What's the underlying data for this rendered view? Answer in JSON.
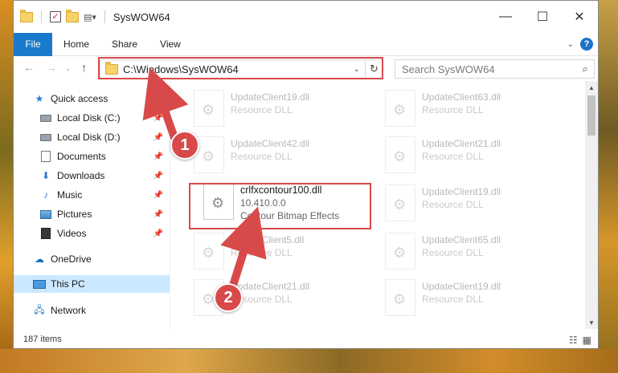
{
  "window": {
    "title": "SysWOW64",
    "controls": {
      "minimize": "—",
      "maximize": "☐",
      "close": "✕"
    }
  },
  "ribbon": {
    "tabs": [
      "File",
      "Home",
      "Share",
      "View"
    ]
  },
  "address": {
    "path": "C:\\Windows\\SysWOW64",
    "search_placeholder": "Search SysWOW64"
  },
  "nav": {
    "items": [
      {
        "label": "Quick access",
        "icon": "star-icon"
      },
      {
        "label": "Local Disk (C:)",
        "icon": "disk-icon",
        "pinned": true
      },
      {
        "label": "Local Disk (D:)",
        "icon": "disk-icon",
        "pinned": true
      },
      {
        "label": "Documents",
        "icon": "document-icon",
        "pinned": true
      },
      {
        "label": "Downloads",
        "icon": "download-icon",
        "pinned": true
      },
      {
        "label": "Music",
        "icon": "music-icon",
        "pinned": true
      },
      {
        "label": "Pictures",
        "icon": "picture-icon",
        "pinned": true
      },
      {
        "label": "Videos",
        "icon": "video-icon",
        "pinned": true
      },
      {
        "label": "OneDrive",
        "icon": "cloud-icon"
      },
      {
        "label": "This PC",
        "icon": "computer-icon",
        "selected": true
      },
      {
        "label": "Network",
        "icon": "network-icon"
      }
    ]
  },
  "files": {
    "left": [
      {
        "name": "UpdateClient19.dll",
        "sub": "Resource DLL"
      },
      {
        "name": "UpdateClient42.dll",
        "sub": "Resource DLL"
      },
      {
        "name": "crlfxcontour100.dll",
        "version": "10.410.0.0",
        "sub": "Contour Bitmap Effects"
      },
      {
        "name": "UpdateClient5.dll",
        "sub": "Resource DLL"
      },
      {
        "name": "UpdateClient21.dll",
        "sub": "Resource DLL"
      }
    ],
    "right": [
      {
        "name": "UpdateClient63.dll",
        "sub": "Resource DLL"
      },
      {
        "name": "UpdateClient21.dll",
        "sub": "Resource DLL"
      },
      {
        "name": "UpdateClient19.dll",
        "sub": "Resource DLL"
      },
      {
        "name": "UpdateClient65.dll",
        "sub": "Resource DLL"
      },
      {
        "name": "UpdateClient19.dll",
        "sub": "Resource DLL"
      }
    ]
  },
  "status": {
    "item_count": "187 items"
  },
  "annotations": {
    "badge1": "1",
    "badge2": "2"
  },
  "colors": {
    "accent": "#1979ca",
    "highlight": "#d84a4a",
    "selected_nav": "#cce8ff"
  }
}
